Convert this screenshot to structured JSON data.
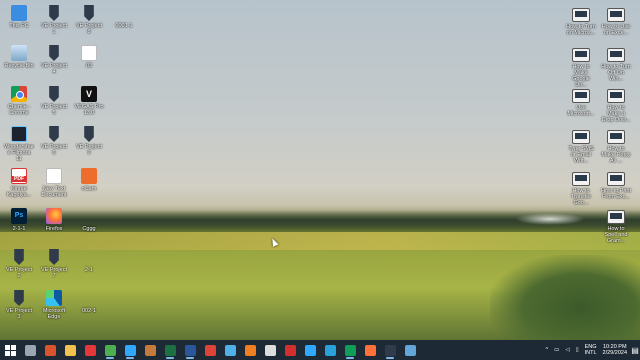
{
  "desktop_icons": [
    {
      "label": "This PC",
      "icon": "computer-icon"
    },
    {
      "label": "VE Project 1",
      "icon": "video-project-icon"
    },
    {
      "label": "VE Project 8",
      "icon": "video-project-icon"
    },
    {
      "label": "0001-1",
      "icon": "file-icon"
    },
    {
      "label": "Recycle Bin",
      "icon": "recycle-bin-icon"
    },
    {
      "label": "VE Project 4",
      "icon": "video-project-icon"
    },
    {
      "label": "03",
      "icon": "document-icon"
    },
    {
      "label": "Chemie - Chrome",
      "icon": "chrome-icon"
    },
    {
      "label": "VE Project 5",
      "icon": "video-project-icon"
    },
    {
      "label": "VEGAS Pro 13.0",
      "icon": "vegas-icon"
    },
    {
      "label": "Wondershare Filmora 11",
      "icon": "filmora-icon"
    },
    {
      "label": "VE Project 6",
      "icon": "video-project-icon"
    },
    {
      "label": "VE Project 9",
      "icon": "video-project-icon"
    },
    {
      "label": "Kinnar Kagoiya...",
      "icon": "pdf-icon"
    },
    {
      "label": "New Text Document",
      "icon": "text-document-icon"
    },
    {
      "label": "oCam",
      "icon": "ocam-icon"
    },
    {
      "label": "2-1-1",
      "icon": "photoshop-icon"
    },
    {
      "label": "Firefox",
      "icon": "firefox-icon"
    },
    {
      "label": "Cggg",
      "icon": "file-icon"
    },
    {
      "label": "VE Project 2",
      "icon": "video-project-icon"
    },
    {
      "label": "VE Project 7",
      "icon": "video-project-icon"
    },
    {
      "label": "2-1",
      "icon": "file-icon"
    },
    {
      "label": "VE Project 3",
      "icon": "video-project-icon"
    },
    {
      "label": "Microsoft Edge",
      "icon": "edge-icon"
    },
    {
      "label": "002-1",
      "icon": "file-icon"
    }
  ],
  "right_icons": [
    {
      "label": "How to Turn on Micros..."
    },
    {
      "label": "How to Use on Exce..."
    },
    {
      "label": "How to Make Google Do..."
    },
    {
      "label": "How to Turn Off On Win..."
    },
    {
      "label": "Use Microsoft..."
    },
    {
      "label": "How to Make a Drop Dow..."
    },
    {
      "label": "Type SMS or Email Writ..."
    },
    {
      "label": "How to Make Reply All ..."
    },
    {
      "label": "How to Transfer Goo..."
    },
    {
      "label": "How to Print From Exc..."
    },
    {
      "label": "How to Spell and Gram..."
    }
  ],
  "taskbar": {
    "apps": [
      {
        "name": "task-view-button",
        "color": "#9aa6b2"
      },
      {
        "name": "browser-app",
        "color": "#d9532c",
        "active": false
      },
      {
        "name": "file-explorer-app",
        "color": "#f2c14e"
      },
      {
        "name": "anydesk-app",
        "color": "#e4373a"
      },
      {
        "name": "chrome-app",
        "color": "#4caf50",
        "active": true
      },
      {
        "name": "photoshop-app",
        "color": "#31a8ff",
        "active": true
      },
      {
        "name": "app-7",
        "color": "#c47a3a"
      },
      {
        "name": "excel-app",
        "color": "#1d7044",
        "active": true
      },
      {
        "name": "word-app",
        "color": "#2b579a",
        "active": true
      },
      {
        "name": "chrome-app-2",
        "color": "#db4437"
      },
      {
        "name": "app-11",
        "color": "#50b0e8"
      },
      {
        "name": "app-12",
        "color": "#f07f22"
      },
      {
        "name": "app-13",
        "color": "#dddddd"
      },
      {
        "name": "acrobat-app",
        "color": "#d32f2f"
      },
      {
        "name": "photoshop-app-2",
        "color": "#31a8ff"
      },
      {
        "name": "telegram-app",
        "color": "#2aa1da"
      },
      {
        "name": "chrome-app-3",
        "color": "#0f9d58",
        "active": true
      },
      {
        "name": "firefox-app",
        "color": "#ff7139"
      },
      {
        "name": "vegas-app",
        "color": "#2f3b4a",
        "active": true
      },
      {
        "name": "screen-app",
        "color": "#63a4d9"
      }
    ],
    "tray": {
      "lang_1": "ENG",
      "lang_2": "INTL",
      "time": "10:20 PM",
      "date": "2/29/2024"
    }
  }
}
